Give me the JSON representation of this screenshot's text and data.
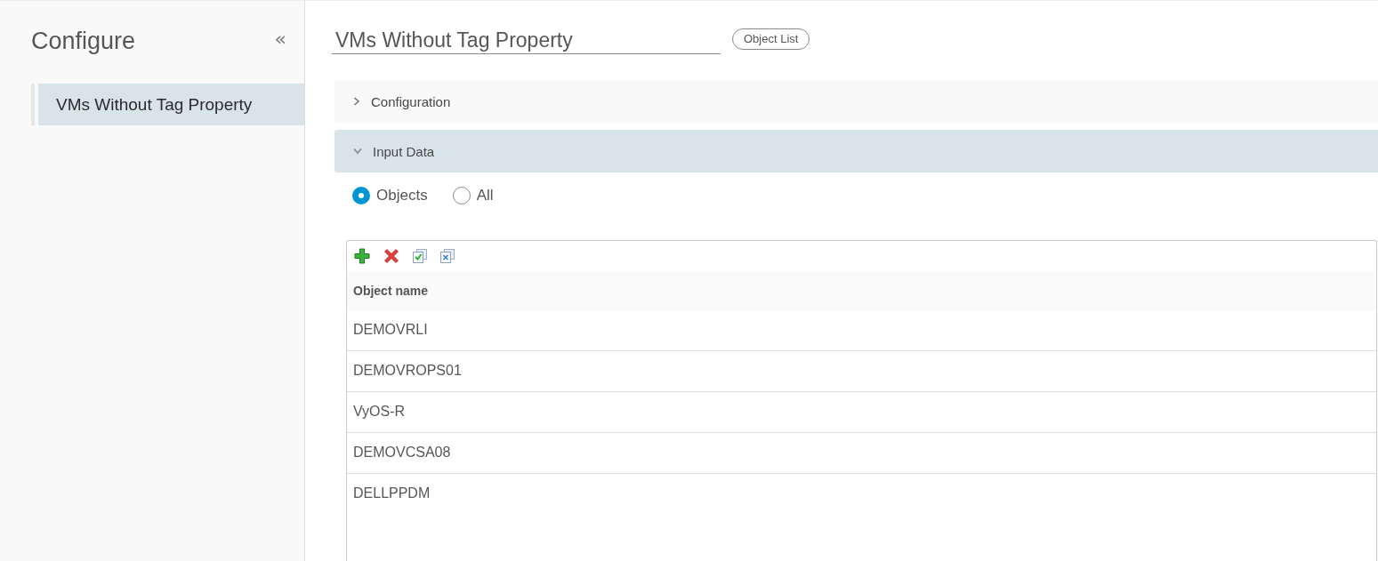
{
  "sidebar": {
    "title": "Configure",
    "collapse_button": "«",
    "items": [
      {
        "label": "VMs Without Tag Property",
        "selected": true
      }
    ]
  },
  "header": {
    "name_value": "VMs Without Tag Property",
    "badge": "Object List"
  },
  "sections": [
    {
      "title": "Configuration",
      "expanded": false
    },
    {
      "title": "Input Data",
      "expanded": true,
      "options": [
        {
          "label": "Objects",
          "selected": true
        },
        {
          "label": "All",
          "selected": false
        }
      ],
      "table": {
        "toolbar": [
          {
            "kind": "add"
          },
          {
            "kind": "remove"
          },
          {
            "kind": "select_all"
          },
          {
            "kind": "deselect_all"
          }
        ],
        "columns": [
          "Object name"
        ],
        "rows": [
          [
            "DEMOVRLI"
          ],
          [
            "DEMOVROPS01"
          ],
          [
            "VyOS-R"
          ],
          [
            "DEMOVCSA08"
          ],
          [
            "DELLPPDM"
          ]
        ]
      }
    }
  ]
}
